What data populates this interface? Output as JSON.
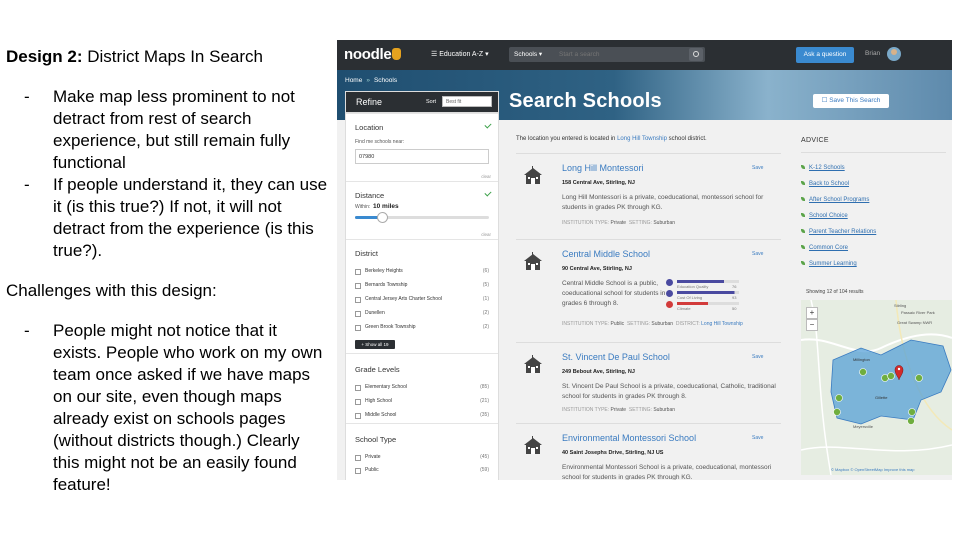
{
  "slide": {
    "design_prefix": "Design 2:",
    "design_title": " District Maps In Search",
    "goals": [
      "Make map less prominent to not detract from rest of search experience, but still remain fully functional",
      "If people understand it, they can use it (is this true?)  If not, it will not detract from the experience (is this true?)."
    ],
    "challenges_heading": "Challenges with this design:",
    "challenges": [
      "People might not notice that it exists.  People who work on my own team once asked if we have maps on our site, even though maps already exist on schools pages (without districts though.)  Clearly this might not be an easily found feature!"
    ],
    "bullet_dash": "-"
  },
  "app": {
    "logo": "noodle",
    "nav_menu": "☰ Education A-Z ▾",
    "search_scope": "Schools ▾",
    "search_placeholder": "Start a search",
    "ask_button": "Ask a question",
    "user_name": "Brian",
    "breadcrumb": [
      "Home",
      "Schools"
    ],
    "breadcrumb_sep": "»",
    "page_title": "Search Schools",
    "save_search": "☐ Save This Search"
  },
  "refine": {
    "title": "Refine",
    "sort_label": "Sort",
    "sort_value": "Best fit",
    "location": {
      "title": "Location",
      "hint": "Find me schools near:",
      "value": "07980",
      "clear": "clear"
    },
    "distance": {
      "title": "Distance",
      "within": "Within:",
      "miles": "10  miles",
      "clear": "clear",
      "fraction": 0.2
    },
    "district": {
      "title": "District",
      "items": [
        {
          "name": "Berkeley Heights",
          "count": "(6)"
        },
        {
          "name": "Bernards Township",
          "count": "(5)"
        },
        {
          "name": "Central Jersey Arts Charter School",
          "count": "(1)"
        },
        {
          "name": "Dunellen",
          "count": "(2)"
        },
        {
          "name": "Green Brook Township",
          "count": "(2)"
        }
      ],
      "show_all": "+ Show all 19"
    },
    "grade_levels": {
      "title": "Grade Levels",
      "items": [
        {
          "name": "Elementary School",
          "count": "(85)"
        },
        {
          "name": "High School",
          "count": "(21)"
        },
        {
          "name": "Middle School",
          "count": "(35)"
        }
      ]
    },
    "school_type": {
      "title": "School Type",
      "items": [
        {
          "name": "Private",
          "count": "(45)"
        },
        {
          "name": "Public",
          "count": "(59)"
        }
      ]
    }
  },
  "results": {
    "location_note_prefix": "The location you entered is located in ",
    "location_note_district": "Long Hill Township",
    "location_note_suffix": " school district.",
    "save_label": "Save",
    "type_label": "INSTITUTION TYPE:",
    "setting_label": "SETTING:",
    "district_label": "DISTRICT:",
    "cards": [
      {
        "name": "Long Hill Montessori",
        "address": "158 Central Ave, Stirling, NJ",
        "desc": "Long Hill Montessori is a private, coeducational, montessori school for students in grades PK through KG.",
        "type": "Private",
        "setting": "Suburban",
        "district": ""
      },
      {
        "name": "Central Middle School",
        "address": "90 Central Ave, Stirling, NJ",
        "desc": "Central Middle School is a public, coeducational school for students in grades 6 through 8.",
        "type": "Public",
        "setting": "Suburban",
        "district": "Long Hill Township",
        "ratings": [
          {
            "label": "Education Quality",
            "value": "76",
            "color": "#4a4aa0",
            "fraction": 0.76
          },
          {
            "label": "Cost Of Living",
            "value": "93",
            "color": "#4a4aa0",
            "fraction": 0.93
          },
          {
            "label": "Climate",
            "value": "50",
            "color": "#d23b3b",
            "fraction": 0.5
          }
        ]
      },
      {
        "name": "St. Vincent De Paul School",
        "address": "249 Bebout Ave, Stirling, NJ",
        "desc": "St. Vincent De Paul School is a private, coeducational, Catholic, traditional school for students in grades PK through 8.",
        "type": "Private",
        "setting": "Suburban",
        "district": ""
      },
      {
        "name": "Environmental Montessori School",
        "address": "40 Saint Josephs Drive, Stirling, NJ US",
        "desc": "Environmental Montessori School is a private, coeducational, montessori school for students in grades PK through KG.",
        "type": "",
        "setting": "",
        "district": ""
      }
    ]
  },
  "advice": {
    "title": "ADVICE",
    "links": [
      "K-12 Schools",
      "Back to School",
      "After School Programs",
      "School Choice",
      "Parent Teacher Relations",
      "Common Core",
      "Summer Learning"
    ]
  },
  "map": {
    "showing": "Showing 12 of 104 results",
    "zoom_in": "+",
    "zoom_out": "−",
    "attribution": "© Mapbox © OpenStreetMap Improve this map",
    "district_fill": "#4d9bd6",
    "marker_color": "#6fae3f",
    "pin_color": "#d22b2b",
    "place_labels": [
      "Stirling",
      "Millington",
      "Gillette",
      "Meyersville",
      "Passaic River Park",
      "Great Swamp NWR"
    ]
  }
}
